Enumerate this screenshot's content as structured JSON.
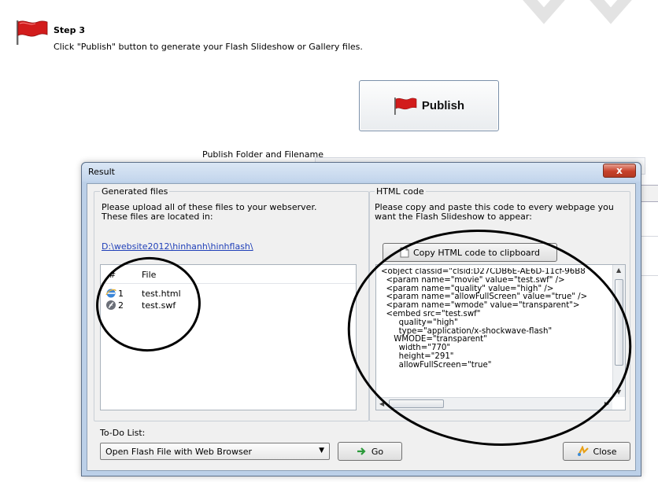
{
  "step": {
    "title": "Step 3",
    "description": "Click \"Publish\" button to generate your Flash Slideshow or Gallery files."
  },
  "publish_button": {
    "label": "Publish",
    "icon": "flag-icon"
  },
  "publish_folder_label": "Publish Folder and Filename",
  "dialog": {
    "title": "Result",
    "close_label": "x",
    "generated_files": {
      "group_title": "Generated files",
      "instructions": "Please upload all of these files to your webserver.",
      "instructions2": "These files are located in:",
      "folder_link": "D:\\website2012\\hinhanh\\hinhflash\\",
      "columns": [
        "#",
        "File"
      ],
      "files": [
        {
          "num": "1",
          "name": "test.html",
          "icon": "ie-icon"
        },
        {
          "num": "2",
          "name": "test.swf",
          "icon": "swf-icon"
        }
      ]
    },
    "html_code": {
      "group_title": "HTML code",
      "instructions": "Please copy and paste this code to every webpage you",
      "instructions2": "want the Flash Slideshow to appear:",
      "copy_button": "Copy HTML code to clipboard",
      "code": "<object classid=\"clsid:D27CDB6E-AE6D-11cf-96B8\n  <param name=\"movie\" value=\"test.swf\" />\n  <param name=\"quality\" value=\"high\" />\n  <param name=\"allowFullScreen\" value=\"true\" />\n  <param name=\"wmode\" value=\"transparent\">\n  <embed src=\"test.swf\"\n       quality=\"high\"\n       type=\"application/x-shockwave-flash\"\n     WMODE=\"transparent\"\n       width=\"770\"\n       height=\"291\"\n       allowFullScreen=\"true\""
    },
    "todo": {
      "label": "To-Do List:",
      "selected": "Open Flash File with Web Browser",
      "go_button": "Go",
      "close_button": "Close"
    }
  },
  "colors": {
    "link": "#1f3fb8",
    "flag_red": "#d21c1c",
    "window_frame": "#bcd0e8",
    "close_red": "#c7412a"
  }
}
